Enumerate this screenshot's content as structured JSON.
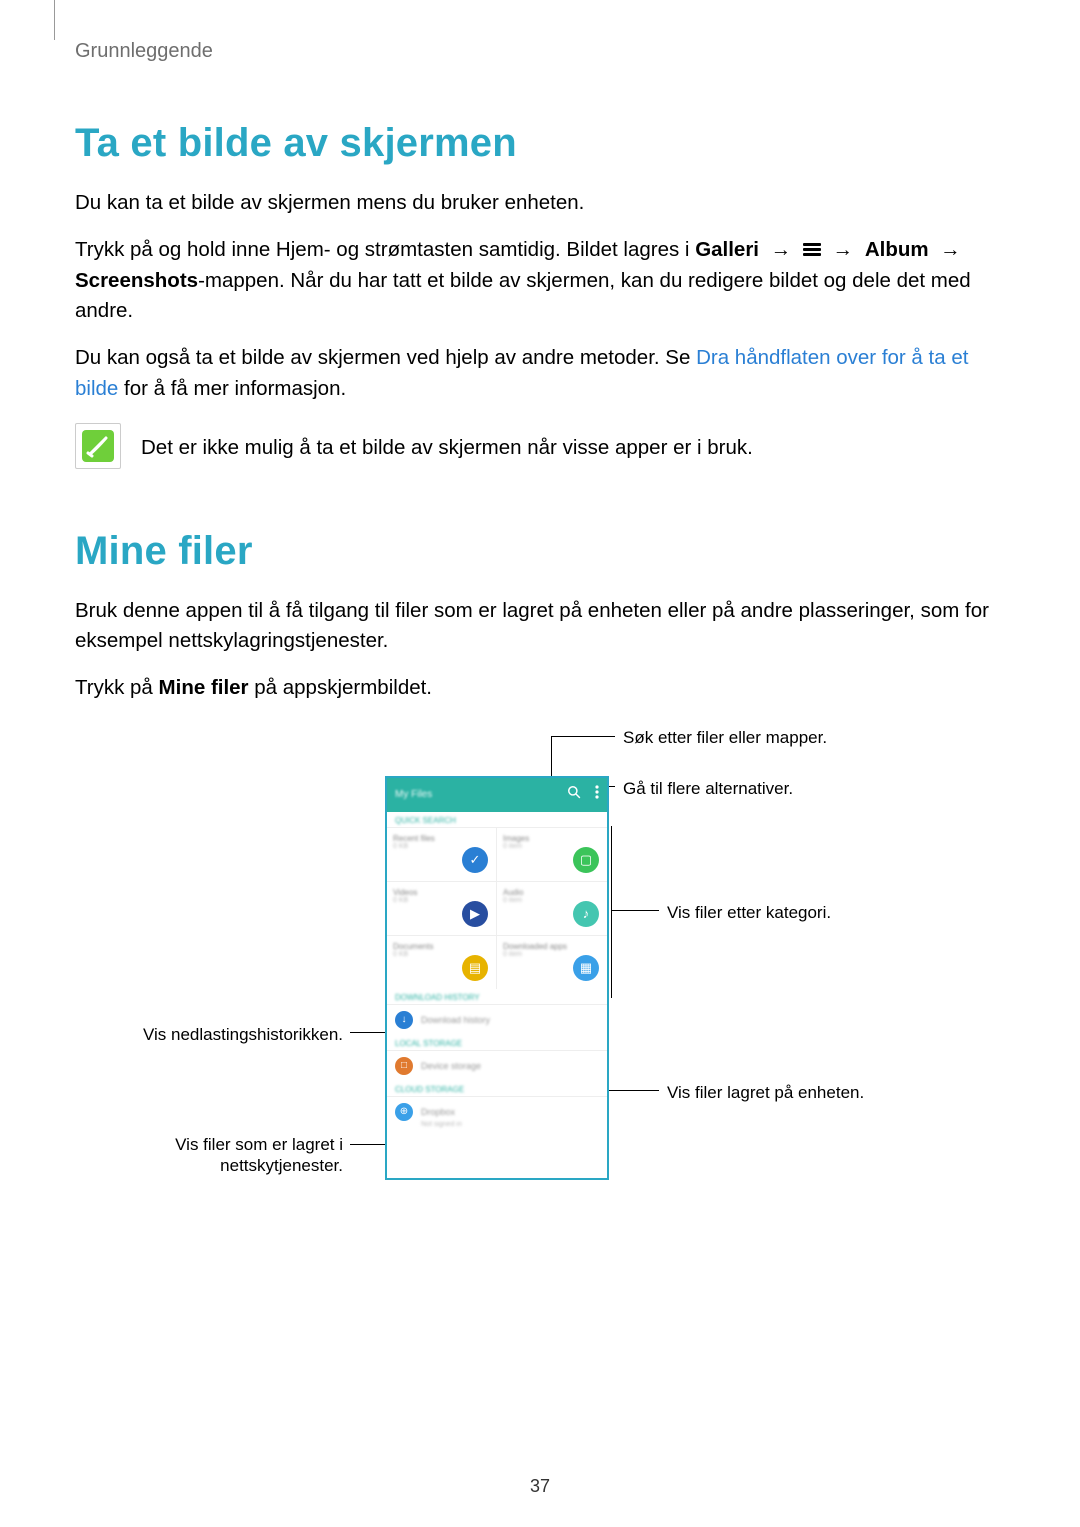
{
  "breadcrumb": "Grunnleggende",
  "section1": {
    "title": "Ta et bilde av skjermen",
    "p1": "Du kan ta et bilde av skjermen mens du bruker enheten.",
    "p2_a": "Trykk på og hold inne Hjem- og strømtasten samtidig. Bildet lagres i ",
    "p2_gallery": "Galleri",
    "p2_arrow1": "→",
    "p2_arrow2": "→",
    "p2_album": "Album",
    "p2_arrow3": "→",
    "p2_screenshots": "Screenshots",
    "p2_b": "-mappen. Når du har tatt et bilde av skjermen, kan du redigere bildet og dele det med andre.",
    "p3_a": "Du kan også ta et bilde av skjermen ved hjelp av andre metoder. Se ",
    "p3_link": "Dra håndflaten over for å ta et bilde",
    "p3_b": " for å få mer informasjon.",
    "note": "Det er ikke mulig å ta et bilde av skjermen når visse apper er i bruk."
  },
  "section2": {
    "title": "Mine filer",
    "p1": "Bruk denne appen til å få tilgang til filer som er lagret på enheten eller på andre plasseringer, som for eksempel nettskylagringstjenester.",
    "p2_a": "Trykk på ",
    "p2_bold": "Mine filer",
    "p2_b": " på appskjermbildet."
  },
  "phone": {
    "title": "My Files",
    "quick": "QUICK SEARCH",
    "cats": [
      {
        "name": "Recent files",
        "meta": "0 KB"
      },
      {
        "name": "Images",
        "meta": "0 item"
      },
      {
        "name": "Videos",
        "meta": "0 KB"
      },
      {
        "name": "Audio",
        "meta": "0 item"
      },
      {
        "name": "Documents",
        "meta": "0 KB"
      },
      {
        "name": "Downloaded apps",
        "meta": "0 item"
      }
    ],
    "dl_section": "DOWNLOAD HISTORY",
    "dl_row": "Download history",
    "local_section": "LOCAL STORAGE",
    "local_row": "Device storage",
    "cloud_section": "CLOUD STORAGE",
    "cloud_row": "Dropbox",
    "cloud_sub": "Not signed in"
  },
  "callouts": {
    "search": "Søk etter filer eller mapper.",
    "more": "Gå til flere alternativer.",
    "category": "Vis filer etter kategori.",
    "device": "Vis filer lagret på enheten.",
    "downloads": "Vis nedlastingshistorikken.",
    "cloud1": "Vis filer som er lagret i",
    "cloud2": "nettskytjenester."
  },
  "page_number": "37"
}
